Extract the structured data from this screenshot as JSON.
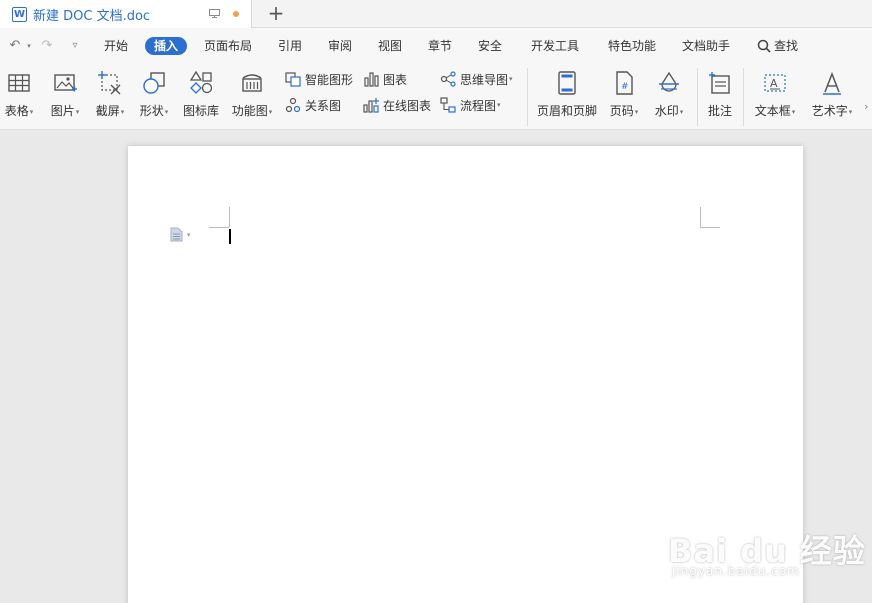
{
  "tab": {
    "title": "新建 DOC 文档.doc",
    "icon_letter": "W",
    "modified_dot_color": "#f0a24b",
    "new_tab_symbol": "+"
  },
  "quick_access": {
    "undo_icon": "undo-icon",
    "redo_icon": "redo-icon",
    "customize_icon": "customize-icon"
  },
  "menu": {
    "items": [
      "开始",
      "插入",
      "页面布局",
      "引用",
      "审阅",
      "视图",
      "章节",
      "安全",
      "开发工具",
      "特色功能",
      "文档助手"
    ],
    "active": "插入",
    "search_label": "查找"
  },
  "ribbon": {
    "table": "表格",
    "picture": "图片",
    "screenshot": "截屏",
    "shape": "形状",
    "icon_lib": "图标库",
    "func_chart": "功能图",
    "smart_shape": "智能图形",
    "chart": "图表",
    "mind_map": "思维导图",
    "relation": "关系图",
    "online_chart": "在线图表",
    "flowchart": "流程图",
    "header_footer": "页眉和页脚",
    "page_num": "页码",
    "watermark": "水印",
    "comment": "批注",
    "textbox": "文本框",
    "wordart": "艺术字"
  },
  "accent_color": "#2d6fd1",
  "watermark": {
    "logo": "Bai du 经验",
    "url": "jingyan.baidu.com"
  }
}
